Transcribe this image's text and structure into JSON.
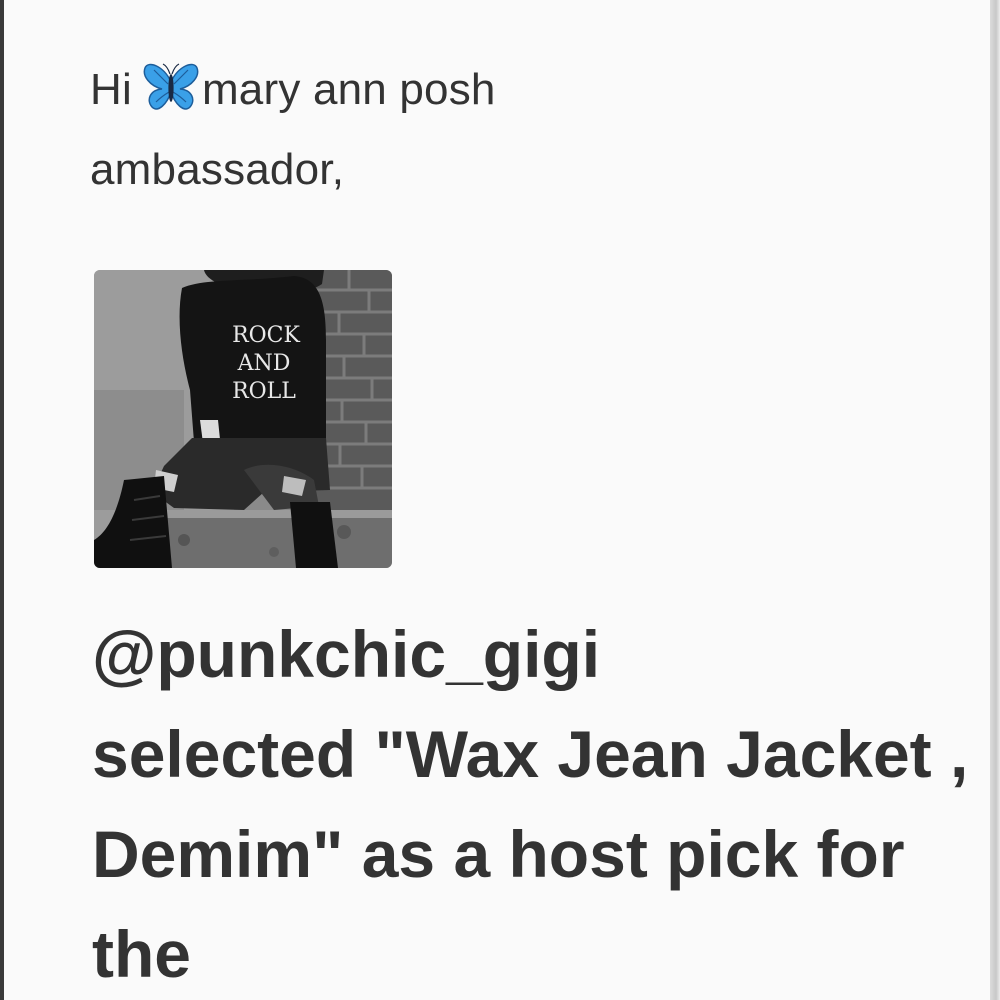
{
  "greeting": {
    "prefix": "Hi",
    "icon": "butterfly-emoji",
    "name_line1": "mary ann posh",
    "name_line2": "ambassador,"
  },
  "avatar": {
    "shirt_text_line1": "ROCK",
    "shirt_text_line2": "AND",
    "shirt_text_line3": "ROLL"
  },
  "notification": {
    "handle": "@punkchic_gigi",
    "message": "selected \"Wax Jean Jacket , Demim\" as a host pick for the"
  },
  "colors": {
    "text": "#333333",
    "background": "#fafafa",
    "butterfly": "#3aa0e8"
  }
}
